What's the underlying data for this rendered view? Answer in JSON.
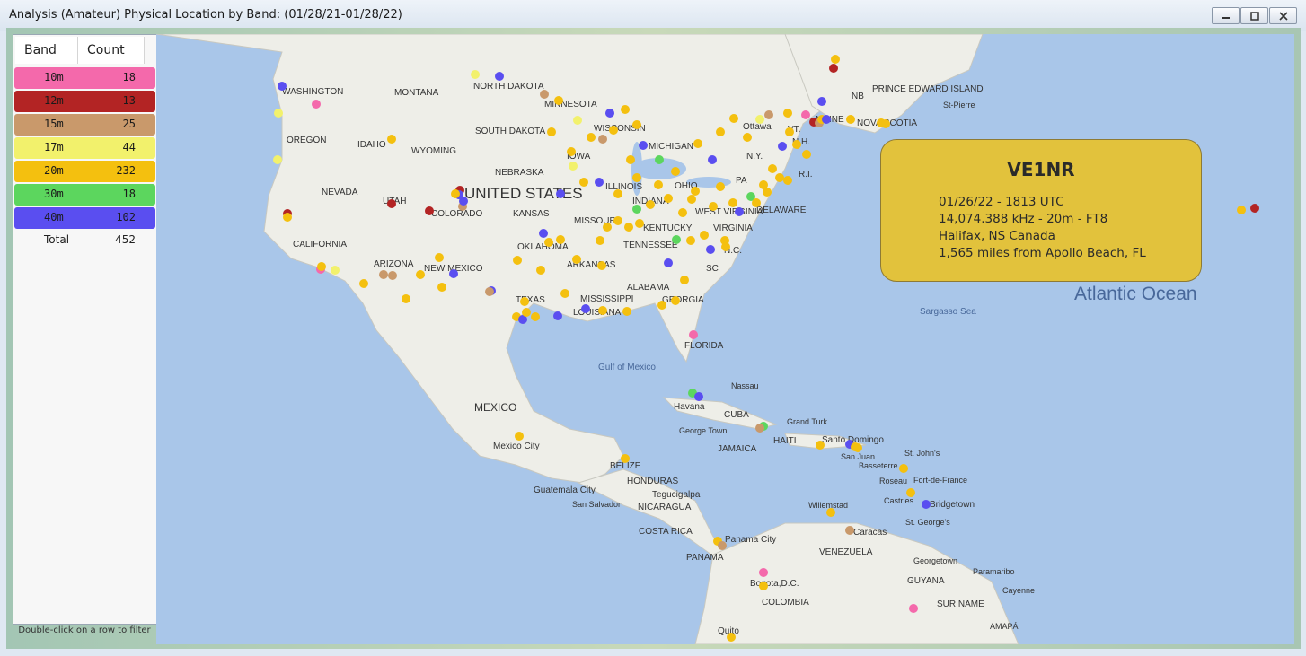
{
  "window": {
    "title": "Analysis (Amateur) Physical Location by Band: (01/28/21-01/28/22)",
    "minimize_icon": "minimize-icon",
    "maximize_icon": "maximize-icon",
    "close_icon": "close-icon"
  },
  "table": {
    "col_band": "Band",
    "col_count": "Count",
    "rows": [
      {
        "band": "10m",
        "count": "18",
        "color": "#f469ab"
      },
      {
        "band": "12m",
        "count": "13",
        "color": "#b32424"
      },
      {
        "band": "15m",
        "count": "25",
        "color": "#c9996b"
      },
      {
        "band": "17m",
        "count": "44",
        "color": "#f2f16c"
      },
      {
        "band": "20m",
        "count": "232",
        "color": "#f4c00f"
      },
      {
        "band": "30m",
        "count": "18",
        "color": "#5cd65e"
      },
      {
        "band": "40m",
        "count": "102",
        "color": "#5a4ef0"
      }
    ],
    "total_label": "Total",
    "total_value": "452",
    "hint": "Double-click on a row to filter"
  },
  "map": {
    "labels": {
      "washington": "WASHINGTON",
      "montana": "MONTANA",
      "north_dakota": "NORTH DAKOTA",
      "minnesota": "MINNESOTA",
      "oregon": "OREGON",
      "idaho": "IDAHO",
      "wyoming": "WYOMING",
      "south_dakota": "SOUTH DAKOTA",
      "wisconsin": "WISCONSIN",
      "michigan": "MICHIGAN",
      "iowa": "IOWA",
      "nebraska": "NEBRASKA",
      "nevada": "NEVADA",
      "utah": "UTAH",
      "united_states": "UNITED STATES",
      "colorado": "COLORADO",
      "kansas": "KANSAS",
      "missouri": "MISSOURI",
      "illinois": "ILLINOIS",
      "indiana": "INDIANA",
      "ohio": "OHIO",
      "kentucky": "KENTUCKY",
      "west_virginia": "WEST VIRGINIA",
      "virginia": "VIRGINIA",
      "california": "CALIFORNIA",
      "arizona": "ARIZONA",
      "new_mexico": "NEW MEXICO",
      "oklahoma": "OKLAHOMA",
      "arkansas": "ARKANSAS",
      "tennessee": "TENNESSEE",
      "nc": "N.C.",
      "sc": "SC",
      "texas": "TEXAS",
      "mississippi": "MISSISSIPPI",
      "alabama": "ALABAMA",
      "georgia": "GEORGIA",
      "louisiana": "LOUISIANA",
      "florida": "FLORIDA",
      "ottawa": "Ottawa",
      "ny": "N.Y.",
      "vt": "VT.",
      "nh": "N.H.",
      "ri": "R.I.",
      "pa": "PA",
      "delaware": "DELAWARE",
      "maine": "MAINE",
      "nb": "NB",
      "pei": "PRINCE EDWARD ISLAND",
      "nova_scotia": "NOVA SCOTIA",
      "st_pierre": "St-Pierre",
      "gulf_of_mexico": "Gulf of Mexico",
      "sargasso_sea": "Sargasso Sea",
      "atlantic_ocean": "Atlantic Ocean",
      "mexico": "MEXICO",
      "mexico_city": "Mexico City",
      "havana": "Havana",
      "cuba": "CUBA",
      "nassau": "Nassau",
      "grand_turk": "Grand Turk",
      "george_town": "George Town",
      "jamaica": "JAMAICA",
      "haiti": "HAITI",
      "santo_domingo": "Santo Domingo",
      "san_juan": "San Juan",
      "basseterre": "Basseterre",
      "st_johns": "St. John's",
      "roseau": "Roseau",
      "fort_de_france": "Fort-de-France",
      "castries": "Castries",
      "bridgetown": "Bridgetown",
      "st_georges": "St. George's",
      "belize": "BELIZE",
      "guatemala_city": "Guatemala City",
      "honduras": "HONDURAS",
      "tegucigalpa": "Tegucigalpa",
      "san_salvador": "San Salvador",
      "nicaragua": "NICARAGUA",
      "costa_rica": "COSTA RICA",
      "panama_city": "Panama City",
      "panama": "PANAMA",
      "willemstad": "Willemstad",
      "caracas": "Caracas",
      "venezuela": "VENEZUELA",
      "bogota": "Bogota,D.C.",
      "colombia": "COLOMBIA",
      "georgetown": "Georgetown",
      "guyana": "GUYANA",
      "paramaribo": "Paramaribo",
      "cayenne": "Cayenne",
      "suriname": "SURINAME",
      "amapa": "AMAPÁ",
      "quito": "Quito"
    }
  },
  "callout": {
    "callsign": "VE1NR",
    "date_time": "01/26/22 - 1813 UTC",
    "freq_band_mode": "14,074.388 kHz - 20m - FT8",
    "location": "Halifax, NS Canada",
    "distance": "1,565 miles from Apollo Beach, FL"
  }
}
